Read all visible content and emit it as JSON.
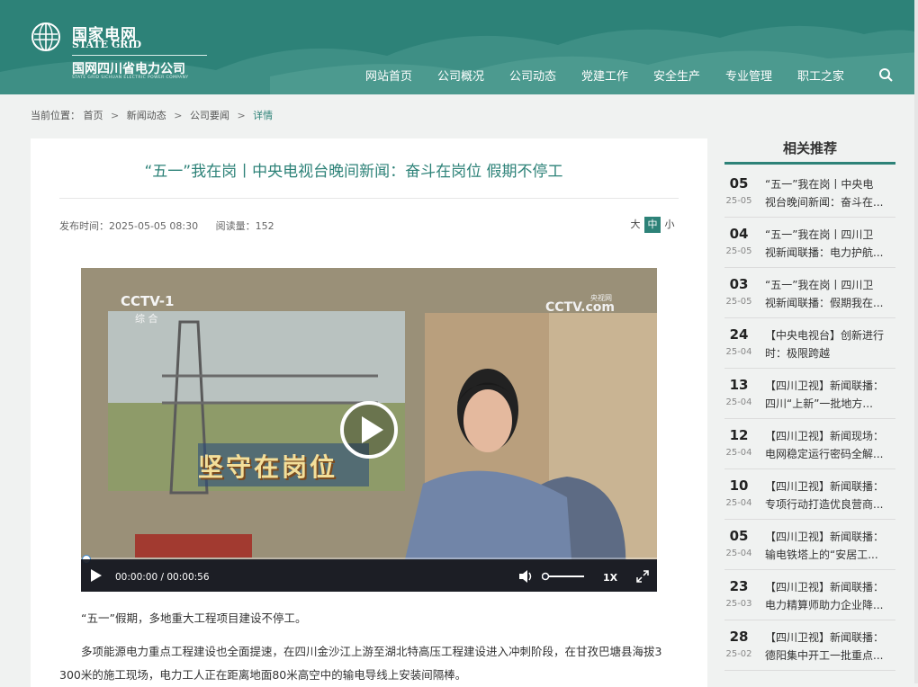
{
  "header": {
    "logo_cn": "国家电网",
    "logo_en": "STATE GRID",
    "company": "国网四川省电力公司",
    "company_en": "STATE GRID SICHUAN ELECTRIC POWER COMPANY",
    "nav": [
      "网站首页",
      "公司概况",
      "公司动态",
      "党建工作",
      "安全生产",
      "专业管理",
      "职工之家"
    ],
    "search_icon": "search-icon"
  },
  "breadcrumb": {
    "label": "当前位置：",
    "items": [
      "首页",
      "新闻动态",
      "公司要闻",
      "详情"
    ],
    "separator": ">"
  },
  "article": {
    "title": "“五一”我在岗丨中央电视台晚间新闻：奋斗在岗位 假期不停工",
    "publish": "发布时间：2025-05-05 08:30",
    "reads": "阅读量：152",
    "font_sizes": [
      "大",
      "中",
      "小"
    ],
    "font_size_selected": "中",
    "video": {
      "channel": "CCTV-1",
      "channel_sub": "综 合",
      "watermark": "CCTV.com",
      "watermark_sub": "央视网",
      "banner_text": "坚守在岗位",
      "time": "00:00:00 / 00:00:56",
      "speed": "1X",
      "progress": 0
    },
    "paragraphs": [
      "“五一”假期，多地重大工程项目建设不停工。",
      "多项能源电力重点工程建设也全面提速，在四川金沙江上游至湖北特高压工程建设进入冲刺阶段，在甘孜巴塘县海拔3",
      "300米的施工现场，电力工人正在距离地面80米高空中的输电导线上安装间隔棒。"
    ]
  },
  "sidebar": {
    "title": "相关推荐",
    "items": [
      {
        "day": "05",
        "ym": "25-05",
        "line1": "“五一”我在岗丨中央电",
        "line2": "视台晚间新闻：奋斗在..."
      },
      {
        "day": "04",
        "ym": "25-05",
        "line1": "“五一”我在岗丨四川卫",
        "line2": "视新闻联播：电力护航..."
      },
      {
        "day": "03",
        "ym": "25-05",
        "line1": "“五一”我在岗丨四川卫",
        "line2": "视新闻联播：假期我在..."
      },
      {
        "day": "24",
        "ym": "25-04",
        "line1": "【中央电视台】创新进行",
        "line2": "时：极限跨越"
      },
      {
        "day": "13",
        "ym": "25-04",
        "line1": "【四川卫视】新闻联播：",
        "line2": "四川“上新”一批地方..."
      },
      {
        "day": "12",
        "ym": "25-04",
        "line1": "【四川卫视】新闻现场：",
        "line2": "电网稳定运行密码全解..."
      },
      {
        "day": "10",
        "ym": "25-04",
        "line1": "【四川卫视】新闻联播：",
        "line2": "专项行动打造优良营商..."
      },
      {
        "day": "05",
        "ym": "25-04",
        "line1": "【四川卫视】新闻联播：",
        "line2": "输电铁塔上的“安居工..."
      },
      {
        "day": "23",
        "ym": "25-03",
        "line1": "【四川卫视】新闻联播：",
        "line2": "电力精算师助力企业降..."
      },
      {
        "day": "28",
        "ym": "25-02",
        "line1": "【四川卫视】新闻联播：",
        "line2": "德阳集中开工一批重点..."
      }
    ]
  }
}
